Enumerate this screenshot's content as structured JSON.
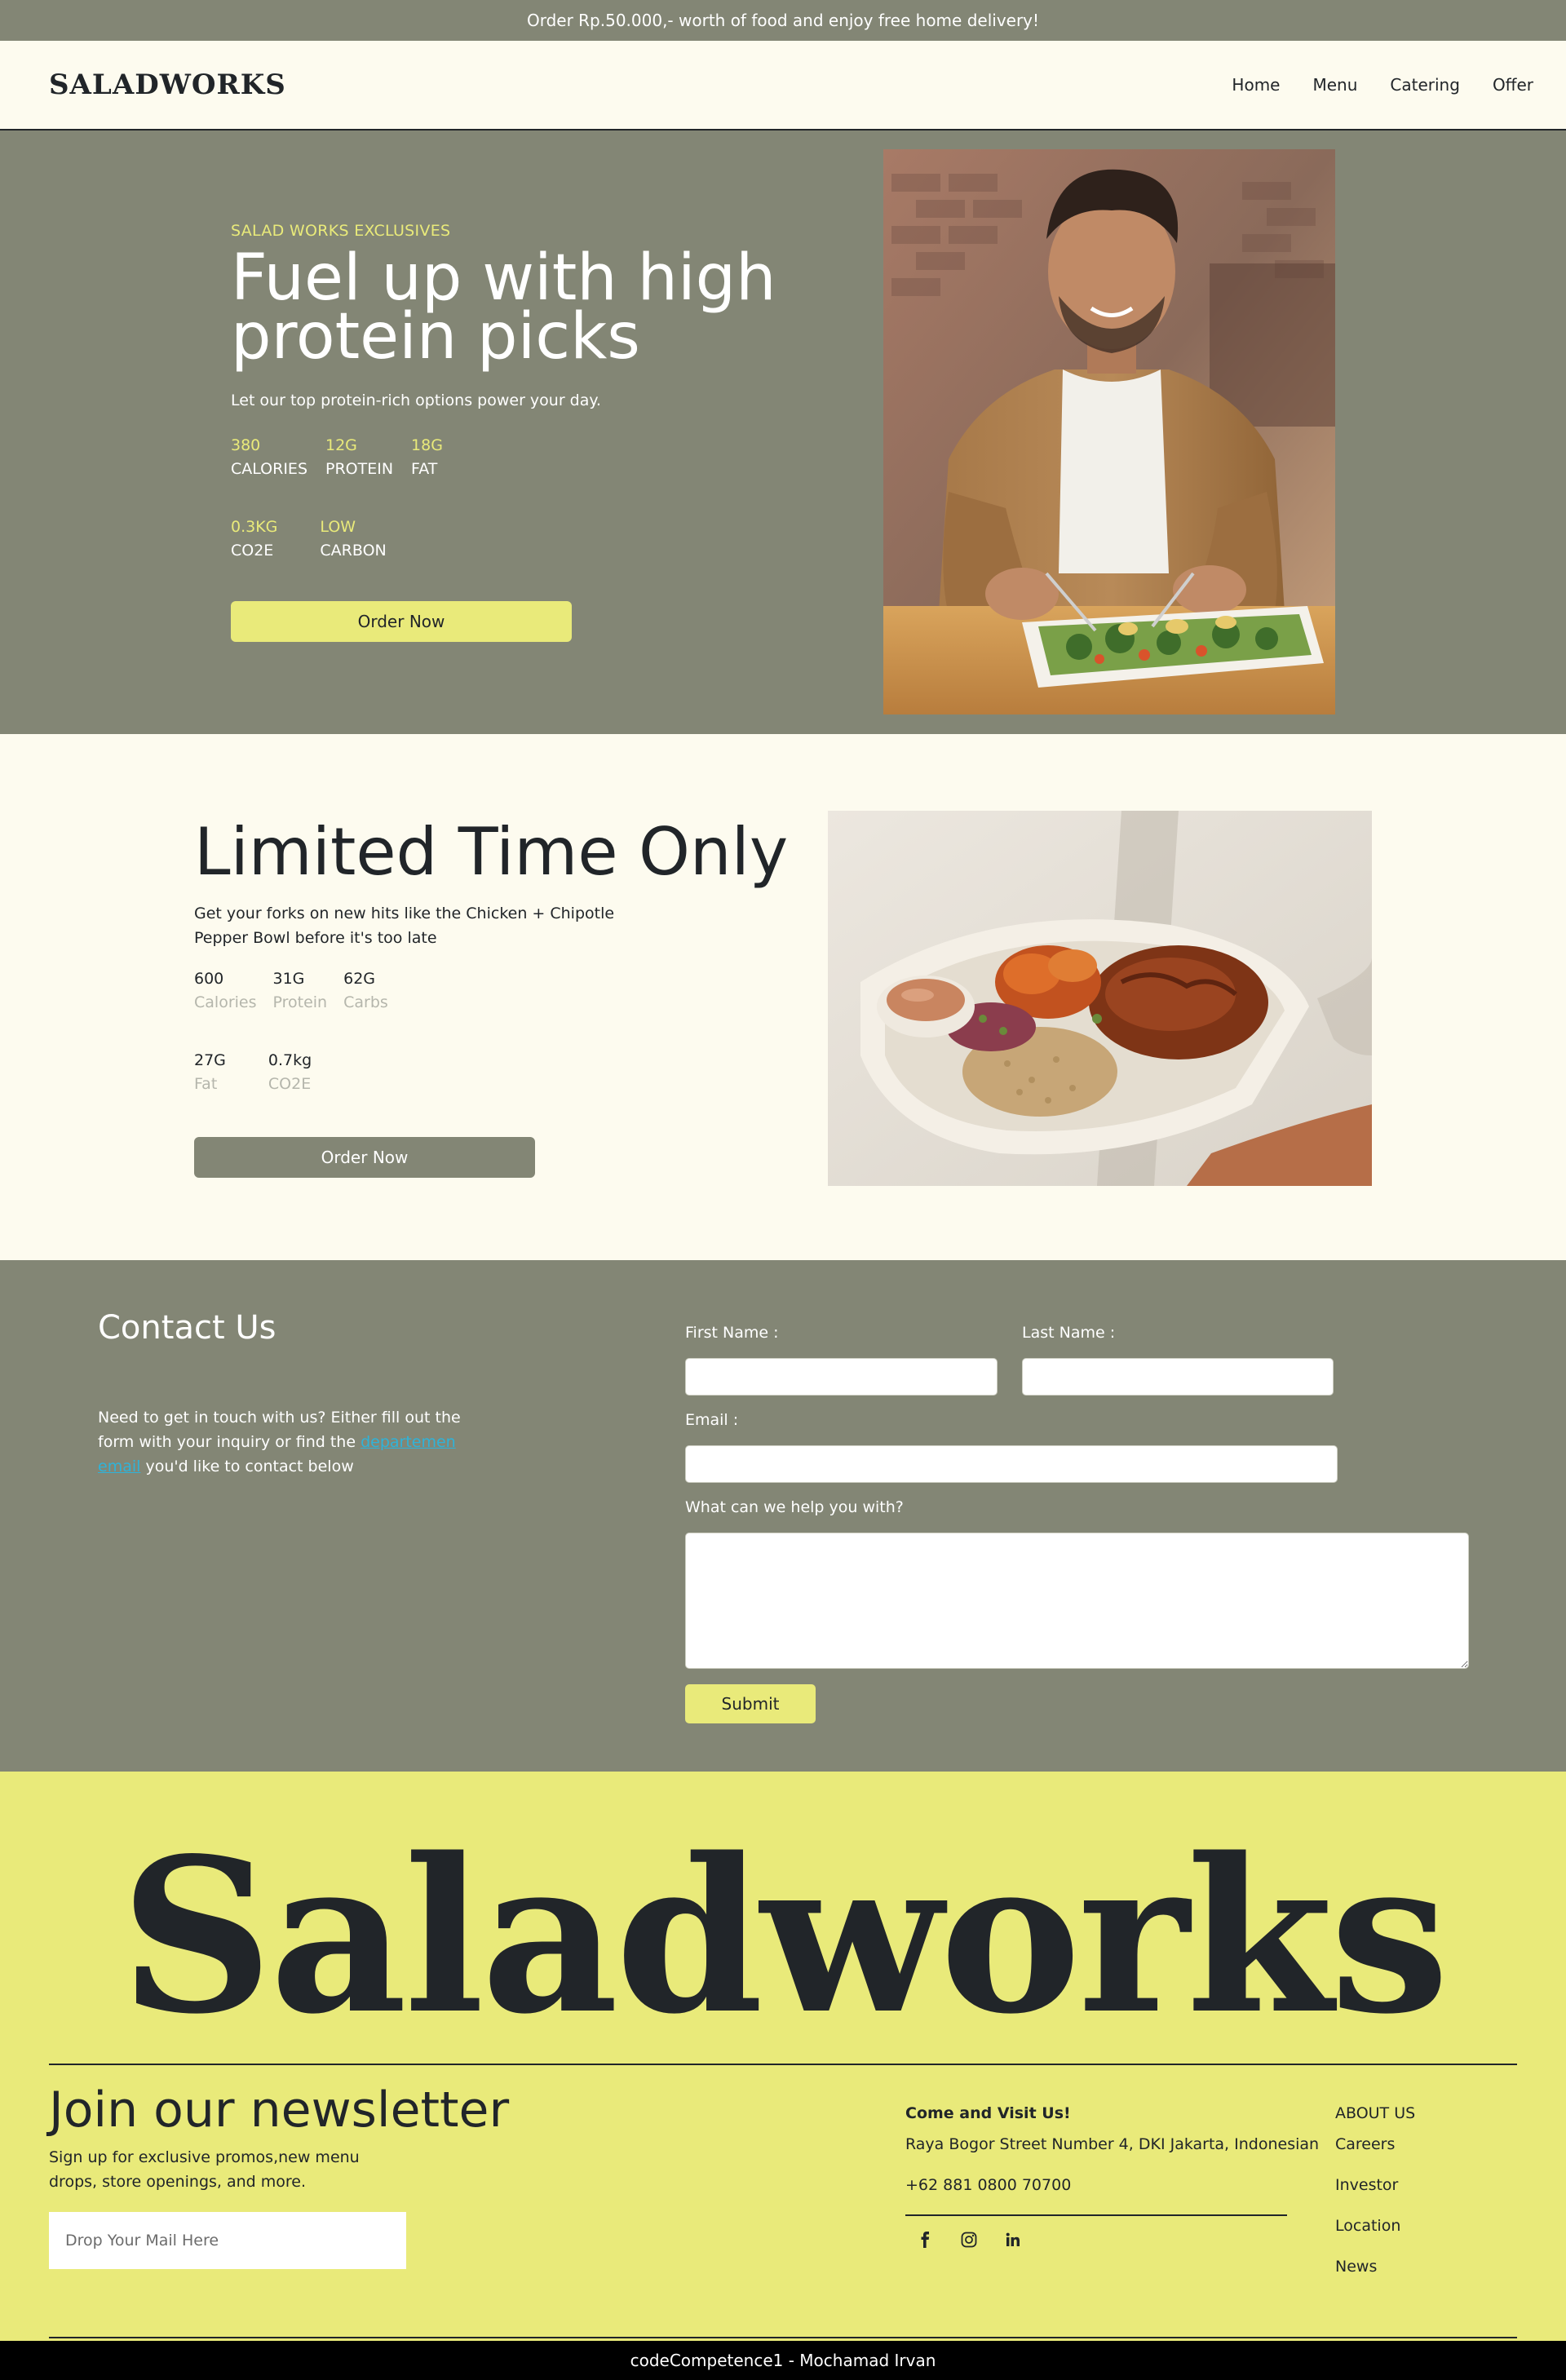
{
  "announcement": "Order Rp.50.000,- worth of food and enjoy free home delivery!",
  "navbar": {
    "brand": "SALADWORKS",
    "links": [
      "Home",
      "Menu",
      "Catering",
      "Offer"
    ]
  },
  "hero": {
    "eyebrow": "SALAD WORKS EXCLUSIVES",
    "title": "Fuel up with high protein picks",
    "subtitle": "Let our top protein-rich options power your day.",
    "stats_row1": [
      {
        "value": "380",
        "label": "CALORIES"
      },
      {
        "value": "12G",
        "label": "PROTEIN"
      },
      {
        "value": "18G",
        "label": "FAT"
      }
    ],
    "stats_row2": [
      {
        "value": "0.3KG",
        "label": "CO2E"
      },
      {
        "value": "LOW",
        "label": "CARBON"
      }
    ],
    "button": "Order Now"
  },
  "limited": {
    "title": "Limited Time Only",
    "subtitle": "Get your forks on new hits like the Chicken + Chipotle Pepper Bowl before it's too late",
    "stats_row1": [
      {
        "value": "600",
        "label": "Calories"
      },
      {
        "value": "31G",
        "label": "Protein"
      },
      {
        "value": "62G",
        "label": "Carbs"
      }
    ],
    "stats_row2": [
      {
        "value": "27G",
        "label": "Fat"
      },
      {
        "value": "0.7kg",
        "label": "CO2E"
      }
    ],
    "button": "Order Now"
  },
  "contact": {
    "title": "Contact Us",
    "text_before": "Need to get in touch with us? Either fill out the form with your inquiry or find the ",
    "link": "departemen email",
    "text_after": " you'd like to contact below",
    "first_name_label": "First Name :",
    "last_name_label": "Last Name :",
    "email_label": "Email :",
    "message_label": "What can we help you with?",
    "submit": "Submit"
  },
  "footer": {
    "big_logo": "Saladworks",
    "newsletter_title": "Join our newsletter",
    "newsletter_sub": "Sign up for exclusive promos,new menu drops, store openings, and more.",
    "newsletter_placeholder": "Drop Your Mail Here",
    "visit_title": "Come and Visit Us!",
    "visit_address": "Raya Bogor Street Number 4, DKI Jakarta, Indonesian",
    "visit_phone": "+62 881 0800 70700",
    "socials": [
      "facebook-icon",
      "instagram-icon",
      "linkedin-icon"
    ],
    "about_title": "ABOUT US",
    "about_items": [
      "Careers",
      "Investor",
      "Location",
      "News"
    ]
  },
  "bottombar": "codeCompetence1 - Mochamad Irvan",
  "colors": {
    "olive": "#838675",
    "cream": "#fdfbef",
    "yellow": "#e9ea7a",
    "dark": "#212529",
    "link": "#2fb3d9"
  }
}
